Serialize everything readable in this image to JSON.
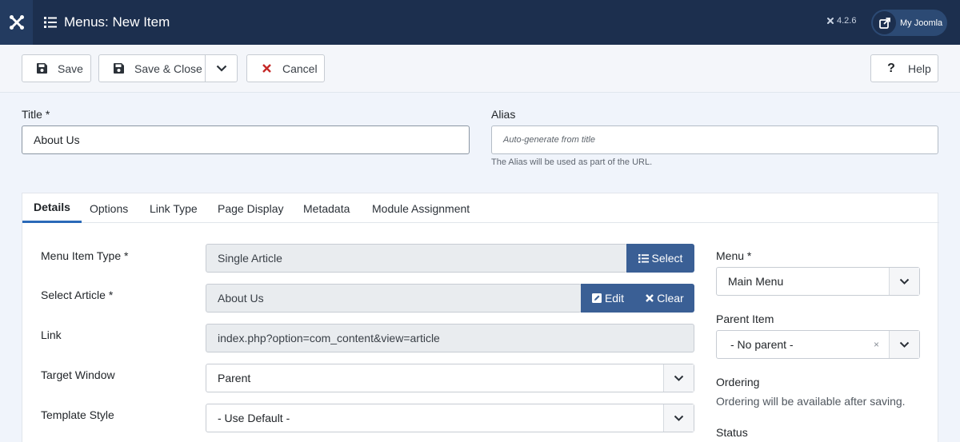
{
  "header": {
    "title": "Menus: New Item",
    "version": "4.2.6",
    "my_joomla_label": "My Joomla"
  },
  "toolbar": {
    "save_label": "Save",
    "save_close_label": "Save & Close",
    "cancel_label": "Cancel",
    "help_label": "Help"
  },
  "title_field": {
    "label": "Title *",
    "value": "About Us"
  },
  "alias_field": {
    "label": "Alias",
    "placeholder": "Auto-generate from title",
    "hint": "The Alias will be used as part of the URL."
  },
  "tabs": [
    {
      "label": "Details"
    },
    {
      "label": "Options"
    },
    {
      "label": "Link Type"
    },
    {
      "label": "Page Display"
    },
    {
      "label": "Metadata"
    },
    {
      "label": "Module Assignment"
    }
  ],
  "details": {
    "menu_item_type": {
      "label": "Menu Item Type *",
      "value": "Single Article",
      "select_label": "Select"
    },
    "select_article": {
      "label": "Select Article *",
      "value": "About Us",
      "edit_label": "Edit",
      "clear_label": "Clear"
    },
    "link": {
      "label": "Link",
      "value": "index.php?option=com_content&view=article"
    },
    "target_window": {
      "label": "Target Window",
      "value": "Parent"
    },
    "template_style": {
      "label": "Template Style",
      "value": "- Use Default -"
    }
  },
  "sidebar": {
    "menu": {
      "label": "Menu *",
      "value": "Main Menu"
    },
    "parent_item": {
      "label": "Parent Item",
      "value": "- No parent -",
      "clear_symbol": "×"
    },
    "ordering": {
      "label": "Ordering",
      "text": "Ordering will be available after saving."
    },
    "status": {
      "label": "Status"
    }
  },
  "colors": {
    "header_bg": "#1c2f4e",
    "accent_blue": "#3a5f95",
    "cancel_red": "#c52827",
    "active_tab_border": "#2a69b8"
  }
}
